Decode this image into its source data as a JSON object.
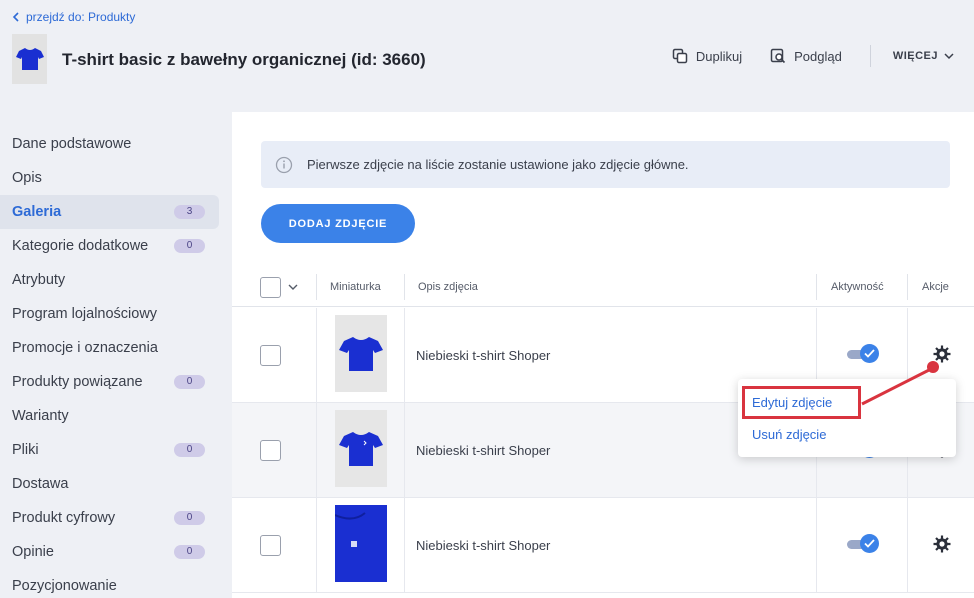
{
  "nav": {
    "back_label": "przejdź do: Produkty"
  },
  "product": {
    "title": "T-shirt basic z bawełny organicznej (id: 3660)"
  },
  "header_actions": {
    "duplicate_label": "Duplikuj",
    "preview_label": "Podgląd",
    "more_label": "WIĘCEJ"
  },
  "sidebar": {
    "items": [
      {
        "label": "Dane podstawowe",
        "badge": null
      },
      {
        "label": "Opis",
        "badge": null
      },
      {
        "label": "Galeria",
        "badge": "3",
        "active": true
      },
      {
        "label": "Kategorie dodatkowe",
        "badge": "0"
      },
      {
        "label": "Atrybuty",
        "badge": null
      },
      {
        "label": "Program lojalnościowy",
        "badge": null
      },
      {
        "label": "Promocje i oznaczenia",
        "badge": null
      },
      {
        "label": "Produkty powiązane",
        "badge": "0"
      },
      {
        "label": "Warianty",
        "badge": null
      },
      {
        "label": "Pliki",
        "badge": "0"
      },
      {
        "label": "Dostawa",
        "badge": null
      },
      {
        "label": "Produkt cyfrowy",
        "badge": "0"
      },
      {
        "label": "Opinie",
        "badge": "0"
      },
      {
        "label": "Pozycjonowanie",
        "badge": null
      }
    ]
  },
  "gallery": {
    "info_text": "Pierwsze zdjęcie na liście zostanie ustawione jako zdjęcie główne.",
    "add_button_label": "DODAJ ZDJĘCIE",
    "columns": {
      "thumbnail": "Miniaturka",
      "description": "Opis zdjęcia",
      "active": "Aktywność",
      "actions": "Akcje"
    },
    "rows": [
      {
        "description": "Niebieski t-shirt Shoper",
        "active": true
      },
      {
        "description": "Niebieski t-shirt Shoper",
        "active": true
      },
      {
        "description": "Niebieski t-shirt Shoper",
        "active": true
      }
    ]
  },
  "action_menu": {
    "edit_label": "Edytuj zdjęcie",
    "delete_label": "Usuń zdjęcie"
  },
  "colors": {
    "accent": "#3b82e8",
    "link": "#2d6ad6",
    "annotation": "#d9343f",
    "shirt": "#1a2fd1"
  }
}
